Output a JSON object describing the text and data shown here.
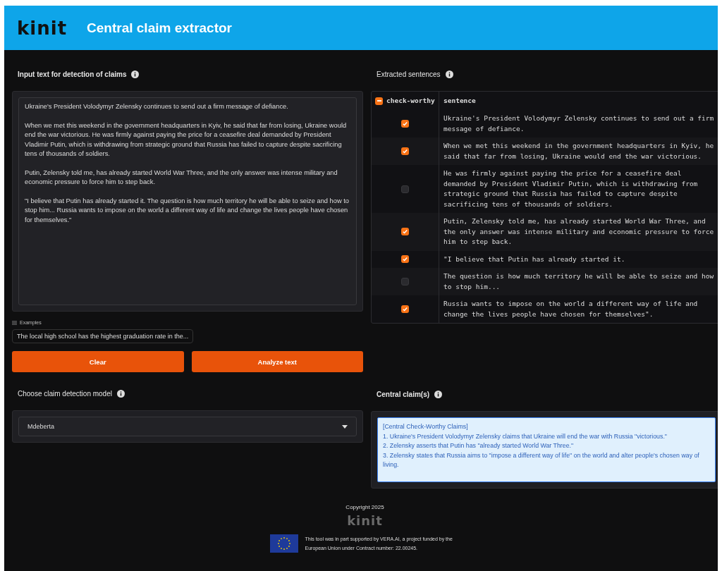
{
  "header": {
    "logo": "kinit",
    "title": "Central claim extractor"
  },
  "input": {
    "label": "Input text for detection of claims",
    "value": "Ukraine's President Volodymyr Zelensky continues to send out a firm message of defiance.\n\nWhen we met this weekend in the government headquarters in Kyiv, he said that far from losing, Ukraine would end the war victorious. He was firmly against paying the price for a ceasefire deal demanded by President Vladimir Putin, which is withdrawing from strategic ground that Russia has failed to capture despite sacrificing tens of thousands of soldiers.\n\nPutin, Zelensky told me, has already started World War Three, and the only answer was intense military and economic pressure to force him to step back.\n\n\"I believe that Putin has already started it. The question is how much territory he will be able to seize and how to stop him... Russia wants to impose on the world a different way of life and change the lives people have chosen for themselves.\""
  },
  "examples": {
    "label": "Examples",
    "items": [
      "The local high school has the highest graduation rate in the..."
    ]
  },
  "buttons": [
    "Clear",
    "Analyze text"
  ],
  "model": {
    "label": "Choose claim detection model",
    "value": "Mdeberta"
  },
  "extracted": {
    "label": "Extracted sentences",
    "columns": [
      "check-worthy",
      "sentence"
    ],
    "header_indeterminate": true,
    "rows": [
      {
        "checked": true,
        "sentence": "Ukraine's President Volodymyr Zelensky continues to send out a firm message of defiance."
      },
      {
        "checked": true,
        "sentence": "When we met this weekend in the government headquarters in Kyiv, he said that far from losing, Ukraine would end the war victorious."
      },
      {
        "checked": false,
        "sentence": "He was firmly against paying the price for a ceasefire deal demanded by President Vladimir Putin, which is withdrawing from strategic ground that Russia has failed to capture despite sacrificing tens of thousands of soldiers."
      },
      {
        "checked": true,
        "sentence": "Putin, Zelensky told me, has already started World War Three, and the only answer was intense military and economic pressure to force him to step back."
      },
      {
        "checked": true,
        "sentence": "\"I believe that Putin has already started it."
      },
      {
        "checked": false,
        "sentence": "The question is how much territory he will be able to seize and how to stop him..."
      },
      {
        "checked": true,
        "sentence": "Russia wants to impose on the world a different way of life and change the lives people have chosen for themselves\"."
      }
    ]
  },
  "central": {
    "label": "Central claim(s)",
    "lines": [
      "[Central Check-Worthy Claims]",
      "1. Ukraine's President Volodymyr Zelensky claims that Ukraine will end the war with Russia \"victorious.\"",
      "2. Zelensky asserts that Putin has \"already started World War Three.\"",
      "3. Zelensky states that Russia aims to \"impose a different way of life\" on the world and alter people's chosen way of living."
    ]
  },
  "footer": {
    "copyright": "Copyright 2025",
    "logo": "kinit",
    "funding": "This tool was in part supported by VERA.AI, a project funded by the European Union under Contract number: 22.00245."
  }
}
